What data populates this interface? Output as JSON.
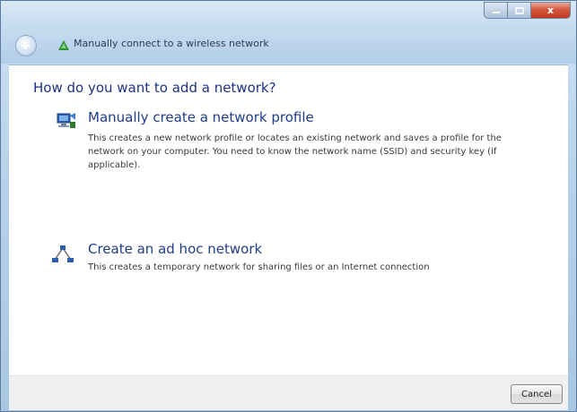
{
  "window": {
    "title": "Manually connect to a wireless network",
    "minimize_glyph": "",
    "maximize_glyph": "",
    "close_glyph": "x"
  },
  "page": {
    "heading": "How do you want to add a network?"
  },
  "options": [
    {
      "icon": "network-profile-icon",
      "title": "Manually create a network profile",
      "description": "This creates a new network profile or locates an existing network and saves a profile for the network on your computer. You need to know the network name (SSID) and security key (if applicable)."
    },
    {
      "icon": "ad-hoc-network-icon",
      "title": "Create an ad hoc network",
      "description": "This creates a temporary network for sharing files or an Internet connection"
    }
  ],
  "footer": {
    "cancel_label": "Cancel"
  },
  "colors": {
    "heading": "#1e3287",
    "link": "#1f3d8a",
    "close_button": "#c3381d"
  }
}
